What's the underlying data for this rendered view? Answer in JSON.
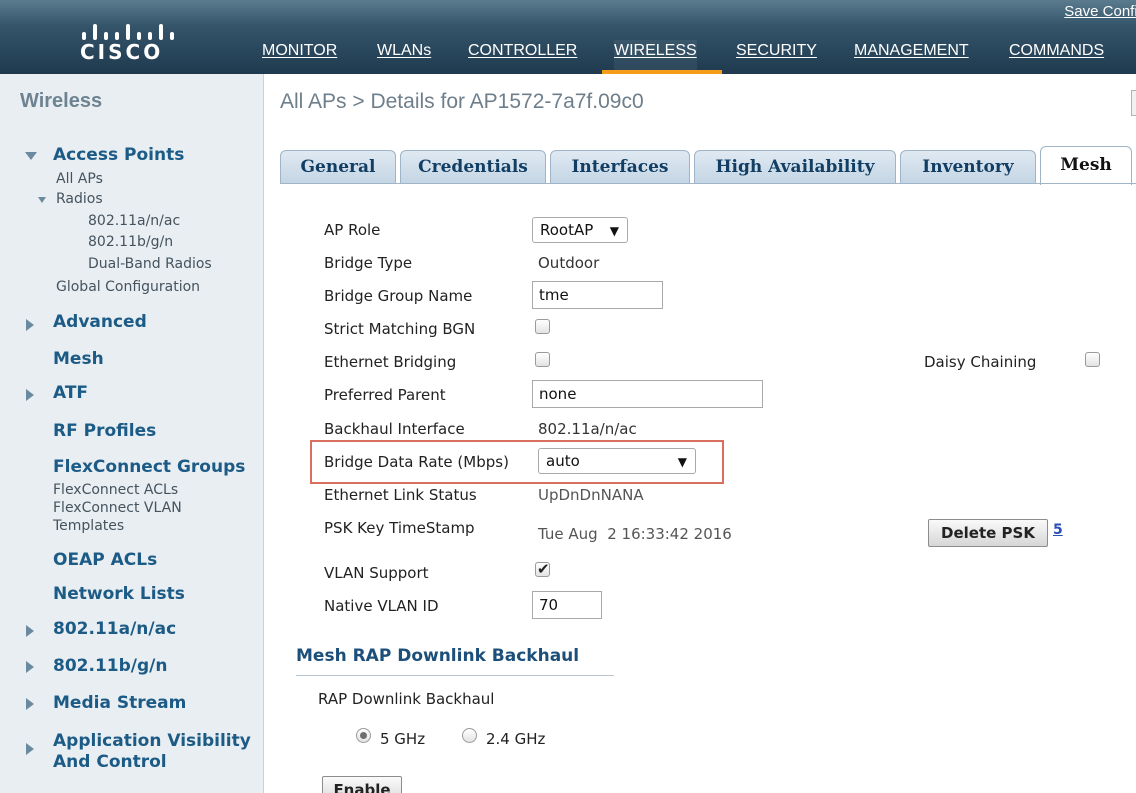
{
  "brand": {
    "logo_text": "CISCO"
  },
  "header": {
    "save_config": "Save Config",
    "nav": [
      {
        "label": "MONITOR"
      },
      {
        "label": "WLANs"
      },
      {
        "label": "CONTROLLER"
      },
      {
        "label": "WIRELESS",
        "active": true
      },
      {
        "label": "SECURITY"
      },
      {
        "label": "MANAGEMENT"
      },
      {
        "label": "COMMANDS"
      }
    ]
  },
  "sidebar": {
    "title": "Wireless",
    "access_points": {
      "label": "Access Points",
      "all_aps": "All APs",
      "radios": {
        "label": "Radios",
        "items": [
          "802.11a/n/ac",
          "802.11b/g/n",
          "Dual-Band Radios"
        ]
      },
      "global_configuration": "Global Configuration"
    },
    "advanced": "Advanced",
    "mesh": "Mesh",
    "atf": "ATF",
    "rf_profiles": "RF Profiles",
    "flexconnect": {
      "label": "FlexConnect Groups",
      "acls": "FlexConnect ACLs",
      "vlan_templates_line1": "FlexConnect VLAN",
      "vlan_templates_line2": "Templates"
    },
    "oeap_acls": "OEAP ACLs",
    "network_lists": "Network Lists",
    "radio_a": "802.11a/n/ac",
    "radio_b": "802.11b/g/n",
    "media_stream": "Media Stream",
    "app_visibility_line1": "Application Visibility",
    "app_visibility_line2": "And Control"
  },
  "main": {
    "breadcrumb": "All APs > Details for AP1572-7a7f.09c0",
    "tabs": [
      {
        "label": "General"
      },
      {
        "label": "Credentials"
      },
      {
        "label": "Interfaces"
      },
      {
        "label": "High Availability"
      },
      {
        "label": "Inventory"
      },
      {
        "label": "Mesh",
        "active": true
      }
    ],
    "fields": {
      "ap_role": {
        "label": "AP Role",
        "value": "RootAP"
      },
      "bridge_type": {
        "label": "Bridge Type",
        "value": "Outdoor"
      },
      "bridge_group_name": {
        "label": "Bridge Group Name",
        "value": "tme"
      },
      "strict_matching_bgn": {
        "label": "Strict Matching BGN",
        "checked": false
      },
      "ethernet_bridging": {
        "label": "Ethernet Bridging",
        "checked": false
      },
      "daisy_chaining": {
        "label": "Daisy Chaining",
        "checked": false
      },
      "preferred_parent": {
        "label": "Preferred Parent",
        "value": "none"
      },
      "backhaul_interface": {
        "label": "Backhaul Interface",
        "value": "802.11a/n/ac"
      },
      "bridge_data_rate": {
        "label": "Bridge Data Rate (Mbps)",
        "value": "auto"
      },
      "ethernet_link_status": {
        "label": "Ethernet Link Status",
        "value": "UpDnDnNANA"
      },
      "psk_key_timestamp": {
        "label": "PSK Key TimeStamp",
        "value": "Tue Aug  2 16:33:42 2016"
      },
      "delete_psk": {
        "label": "Delete PSK",
        "help": "5"
      },
      "vlan_support": {
        "label": "VLAN Support",
        "checked": true
      },
      "native_vlan_id": {
        "label": "Native VLAN ID",
        "value": "70"
      }
    },
    "rap_section": {
      "title": "Mesh RAP Downlink Backhaul",
      "label": "RAP Downlink Backhaul",
      "options": [
        {
          "label": "5 GHz",
          "selected": true
        },
        {
          "label": "2.4 GHz",
          "selected": false
        }
      ],
      "enable_button": "Enable"
    }
  },
  "icons": {
    "collapse": "triangle-down-icon",
    "expand": "triangle-right-icon",
    "dropdown": "caret-down-icon",
    "check": "check-icon"
  }
}
